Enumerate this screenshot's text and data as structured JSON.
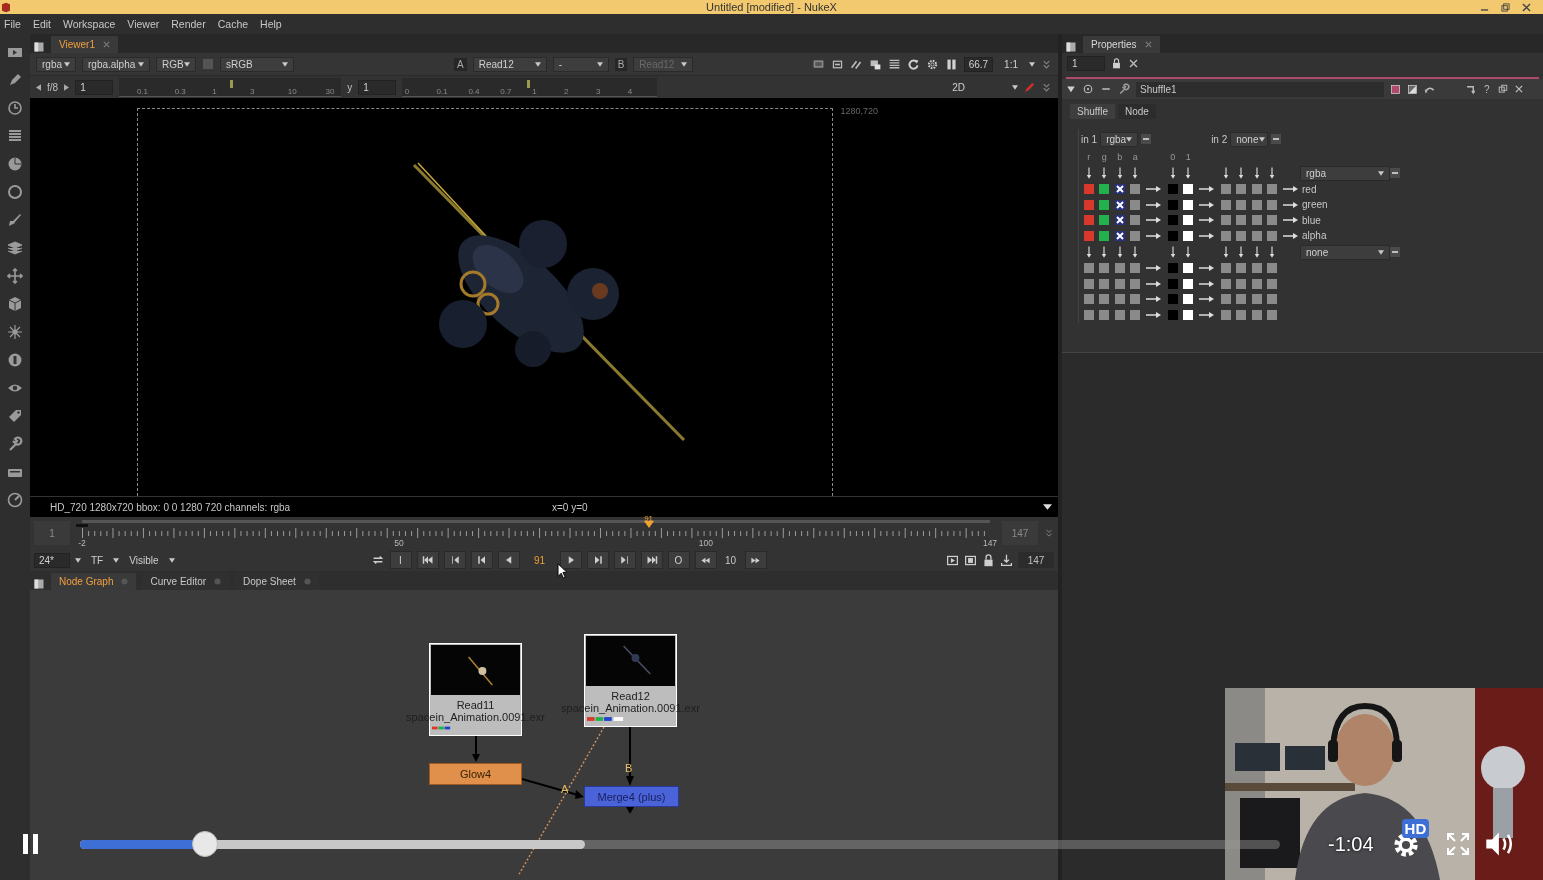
{
  "window": {
    "title": "Untitled [modified] - NukeX"
  },
  "menu": [
    "File",
    "Edit",
    "Workspace",
    "Viewer",
    "Render",
    "Cache",
    "Help"
  ],
  "viewer": {
    "tab": "Viewer1",
    "channels": "rgba",
    "alpha_channel": "rgba.alpha",
    "display": "RGB",
    "lut": "sRGB",
    "input_a_label": "A",
    "input_a": "Read12",
    "compare": "-",
    "input_b_label": "B",
    "input_b": "Read12",
    "zoom": "66.7",
    "scale": "1:1",
    "fstop": "f/8",
    "gain": "1",
    "gain_slider": {
      "level": 0.5
    },
    "gamma_slider": {
      "level": 0.49
    },
    "gain_ticks": [
      "0.1",
      "0.3",
      "1",
      "3",
      "10",
      "30"
    ],
    "gamma_label": "y",
    "gamma": "1",
    "gamma_ticks": [
      "0",
      "0.1",
      "0.4",
      "0.7",
      "1",
      "2",
      "3",
      "4"
    ],
    "mode": "2D",
    "format_corner": "1280,720",
    "info": "HD_720 1280x720  bbox: 0 0 1280 720 channels: rgba",
    "cursor": "x=0 y=0"
  },
  "timeline": {
    "start": "1",
    "end": "147",
    "ticks": [
      "-2",
      "50",
      "100",
      "147"
    ],
    "frame": "91",
    "playhead": {
      "level": 0.624
    },
    "fps": "24*",
    "time_mode": "TF",
    "range": "Visible",
    "in": "I",
    "current": "91",
    "out": "O",
    "increment": "10",
    "last": "147"
  },
  "node_graph": {
    "tabs": [
      {
        "label": "Node Graph",
        "selected": true
      },
      {
        "label": "Curve Editor",
        "selected": false
      },
      {
        "label": "Dope Sheet",
        "selected": false
      }
    ],
    "nodes": [
      {
        "kind": "read",
        "name": "Read11",
        "file": "spacein_Animation.0091.exr"
      },
      {
        "kind": "read",
        "name": "Read12",
        "file": "spacein_Animation.0091.exr"
      },
      {
        "kind": "glow",
        "name": "Glow4"
      },
      {
        "kind": "merge",
        "name": "Merge4 (plus)"
      }
    ],
    "inputs": [
      "A",
      "B"
    ]
  },
  "properties": {
    "tab": "Properties",
    "max_panels": "1",
    "node_name": "Shuffle1",
    "help": "?",
    "tabs": [
      {
        "label": "Shuffle",
        "selected": true
      },
      {
        "label": "Node",
        "selected": false
      }
    ],
    "shuffle": {
      "in1_label": "in 1",
      "in1": "rgba",
      "in2_label": "in 2",
      "in2": "none",
      "in1_channels": [
        "r",
        "g",
        "b",
        "a"
      ],
      "constants": [
        "0",
        "1"
      ],
      "out1": "rgba",
      "out2": "none",
      "out1_rows": [
        {
          "label": "red",
          "cells": [
            {
              "kind": "red"
            },
            {
              "kind": "green"
            },
            {
              "kind": "cross"
            },
            {
              "kind": "grey"
            },
            {
              "kind": "black"
            },
            {
              "kind": "white"
            },
            {
              "kind": "grey"
            },
            {
              "kind": "grey"
            },
            {
              "kind": "grey"
            },
            {
              "kind": "grey"
            }
          ]
        },
        {
          "label": "green",
          "cells": [
            {
              "kind": "red"
            },
            {
              "kind": "green"
            },
            {
              "kind": "cross"
            },
            {
              "kind": "grey"
            },
            {
              "kind": "black"
            },
            {
              "kind": "white"
            },
            {
              "kind": "grey"
            },
            {
              "kind": "grey"
            },
            {
              "kind": "grey"
            },
            {
              "kind": "grey"
            }
          ]
        },
        {
          "label": "blue",
          "cells": [
            {
              "kind": "red"
            },
            {
              "kind": "green"
            },
            {
              "kind": "cross"
            },
            {
              "kind": "grey"
            },
            {
              "kind": "black"
            },
            {
              "kind": "white"
            },
            {
              "kind": "grey"
            },
            {
              "kind": "grey"
            },
            {
              "kind": "grey"
            },
            {
              "kind": "grey"
            }
          ]
        },
        {
          "label": "alpha",
          "cells": [
            {
              "kind": "red"
            },
            {
              "kind": "green"
            },
            {
              "kind": "cross"
            },
            {
              "kind": "grey"
            },
            {
              "kind": "black"
            },
            {
              "kind": "white"
            },
            {
              "kind": "grey"
            },
            {
              "kind": "grey"
            },
            {
              "kind": "grey"
            },
            {
              "kind": "grey"
            }
          ]
        }
      ],
      "out2_rows": [
        {
          "cells": [
            {
              "kind": "grey"
            },
            {
              "kind": "grey"
            },
            {
              "kind": "grey"
            },
            {
              "kind": "grey"
            },
            {
              "kind": "black"
            },
            {
              "kind": "white"
            },
            {
              "kind": "grey"
            },
            {
              "kind": "grey"
            },
            {
              "kind": "grey"
            },
            {
              "kind": "grey"
            }
          ]
        },
        {
          "cells": [
            {
              "kind": "grey"
            },
            {
              "kind": "grey"
            },
            {
              "kind": "grey"
            },
            {
              "kind": "grey"
            },
            {
              "kind": "black"
            },
            {
              "kind": "white"
            },
            {
              "kind": "grey"
            },
            {
              "kind": "grey"
            },
            {
              "kind": "grey"
            },
            {
              "kind": "grey"
            }
          ]
        },
        {
          "cells": [
            {
              "kind": "grey"
            },
            {
              "kind": "grey"
            },
            {
              "kind": "grey"
            },
            {
              "kind": "grey"
            },
            {
              "kind": "black"
            },
            {
              "kind": "white"
            },
            {
              "kind": "grey"
            },
            {
              "kind": "grey"
            },
            {
              "kind": "grey"
            },
            {
              "kind": "grey"
            }
          ]
        },
        {
          "cells": [
            {
              "kind": "grey"
            },
            {
              "kind": "grey"
            },
            {
              "kind": "grey"
            },
            {
              "kind": "grey"
            },
            {
              "kind": "black"
            },
            {
              "kind": "white"
            },
            {
              "kind": "grey"
            },
            {
              "kind": "grey"
            },
            {
              "kind": "grey"
            },
            {
              "kind": "grey"
            }
          ]
        }
      ]
    }
  },
  "player": {
    "progress": {
      "level": 0.104
    },
    "buffered": {
      "level": 0.421
    },
    "time": "-1:04",
    "quality": "HD"
  }
}
